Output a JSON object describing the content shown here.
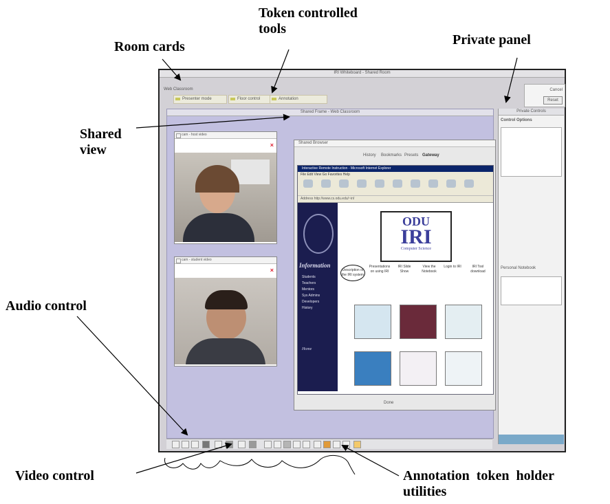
{
  "annotations": {
    "room_cards": "Room cards",
    "token_tools_line1": "Token controlled",
    "token_tools_line2": "tools",
    "private_panel": "Private panel",
    "shared_view_line1": "Shared",
    "shared_view_line2": "view",
    "audio_control": "Audio control",
    "video_control": "Video control",
    "annotation_line1": "Annotation  token  holder",
    "annotation_line2": "utilities"
  },
  "app": {
    "window_title": "IRI Whiteboard - Shared Room",
    "room_label": "Web Classroom",
    "tools": [
      "Presenter mode",
      "Floor control",
      "Annotation"
    ],
    "shared_title": "Shared Frame - Web Classroom",
    "video1_title": "cam - host video",
    "video2_title": "cam - student video",
    "close_glyph": "×",
    "browser_win_title": "Shared Browser",
    "browser_tabs": [
      "History",
      "Bookmarks",
      "Presets",
      "Gateway"
    ],
    "ie_title": "Interactive Remote Instruction - Microsoft Internet Explorer",
    "ie_menu": "File   Edit   View   Go   Favorites   Help",
    "ie_addr": "Address  http://www.cs.odu.edu/~iri/",
    "logo_top": "ODU",
    "logo_main": "IRI",
    "logo_sub": "Computer Science",
    "side_heading": "Information",
    "side_items": [
      "Students",
      "Teachers",
      "Mentors",
      "Sys Admins",
      "Developers",
      "History"
    ],
    "side_bottom": "Home",
    "links": [
      "Description of the IRI system",
      "Presentations on using IRI",
      "IRI Slide Show",
      "View the Notebook",
      "Login to IRI",
      "IRI Tool download"
    ],
    "browser_status": "Done",
    "private_title": "Private Controls",
    "control_options": "Control Options",
    "reset_label": "Reset",
    "cancel_label": "Cancel",
    "recorder_label": "Personal Notebook"
  },
  "colors": {
    "shared_bg": "#c2c0e0",
    "navy": "#1b1d4f",
    "ie_title": "#0a246a",
    "close": "#dd2233"
  }
}
